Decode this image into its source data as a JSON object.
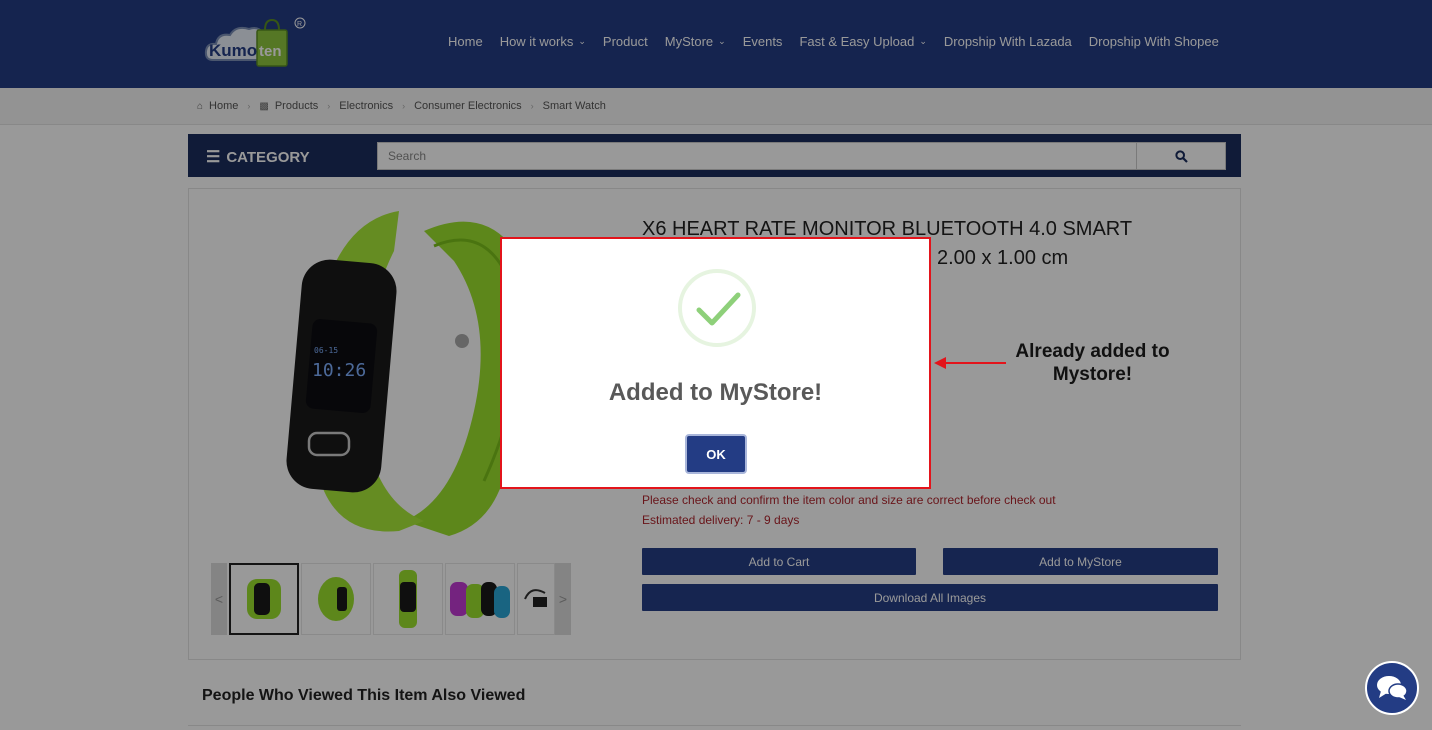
{
  "header": {
    "nav": [
      {
        "label": "Home",
        "dropdown": false
      },
      {
        "label": "How it works",
        "dropdown": true
      },
      {
        "label": "Product",
        "dropdown": false
      },
      {
        "label": "MyStore",
        "dropdown": true
      },
      {
        "label": "Events",
        "dropdown": false
      },
      {
        "label": "Fast & Easy Upload",
        "dropdown": true
      },
      {
        "label": "Dropship With Lazada",
        "dropdown": false
      },
      {
        "label": "Dropship With Shopee",
        "dropdown": false
      }
    ],
    "logo": {
      "text_part1": "Kumo",
      "text_part2": "ten",
      "registered_mark": "®"
    }
  },
  "breadcrumb": [
    "Home",
    "Products",
    "Electronics",
    "Consumer Electronics",
    "Smart Watch"
  ],
  "category_bar": {
    "category_label": "CATEGORY",
    "search_placeholder": "Search"
  },
  "product": {
    "title_line1": "X6 HEART RATE MONITOR BLUETOOTH 4.0 SMART",
    "title_line2_visible": "2.00 x 1.00 cm",
    "watch_time": "10:26",
    "watch_date": "06-15",
    "notice_line1": "Please check and confirm the item color and size are correct before check out",
    "notice_line2": "Estimated delivery: 7 - 9 days",
    "add_to_cart": "Add to Cart",
    "add_to_mystore": "Add to MyStore",
    "download_images": "Download All Images",
    "thumb_prev": "<",
    "thumb_next": ">"
  },
  "related_heading": "People Who Viewed This Item Also Viewed",
  "modal": {
    "title": "Added to MyStore!",
    "ok_label": "OK"
  },
  "annotation": {
    "line1": "Already added to",
    "line2": "Mystore!"
  },
  "colors": {
    "brand_navy": "#233c84",
    "accent_green": "#9be22e",
    "highlight_red": "#e3141b",
    "notice_red": "#b0262e"
  }
}
